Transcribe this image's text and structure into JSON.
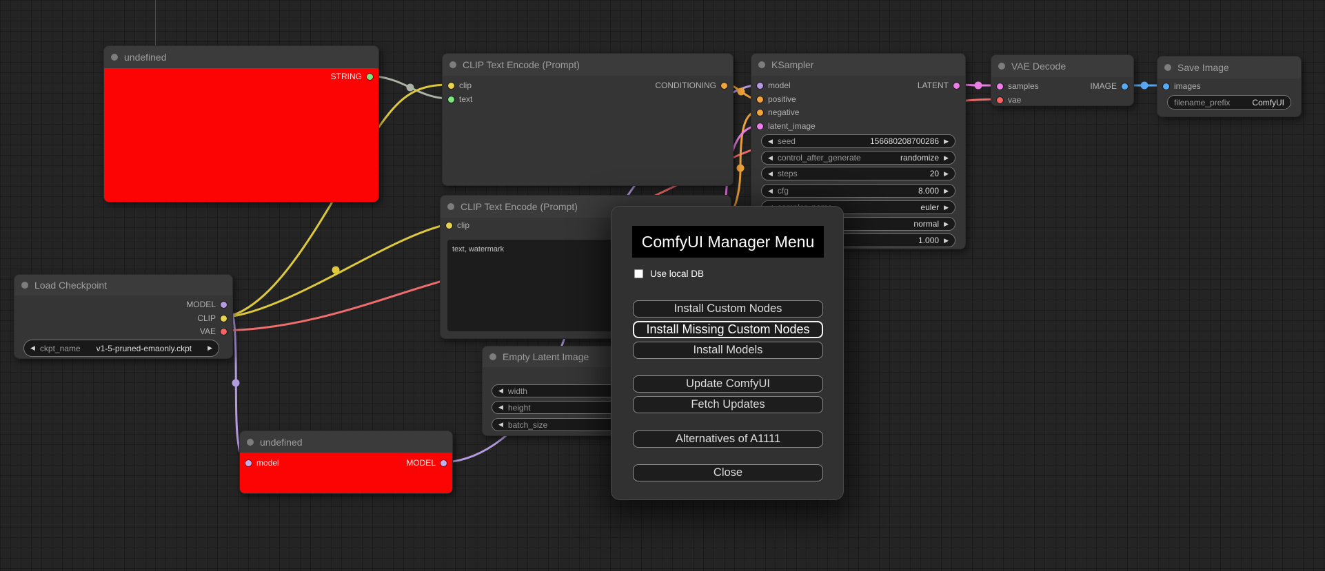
{
  "dialog": {
    "title": "ComfyUI Manager Menu",
    "checkbox_label": "Use local DB",
    "buttons": [
      "Install Custom Nodes",
      "Install Missing Custom Nodes",
      "Install Models",
      "Update ComfyUI",
      "Fetch Updates",
      "Alternatives of A1111",
      "Close"
    ],
    "highlighted_button": "Install Missing Custom Nodes"
  },
  "nodes": {
    "undefined_top": {
      "title": "undefined",
      "outputs": {
        "string": "STRING"
      }
    },
    "clip1": {
      "title": "CLIP Text Encode (Prompt)",
      "inputs": {
        "clip": "clip",
        "text": "text"
      },
      "outputs": {
        "conditioning": "CONDITIONING"
      }
    },
    "ksampler": {
      "title": "KSampler",
      "inputs": {
        "model": "model",
        "positive": "positive",
        "negative": "negative",
        "latent_image": "latent_image"
      },
      "outputs": {
        "latent": "LATENT"
      },
      "widgets": [
        {
          "label": "seed",
          "value": "156680208700286"
        },
        {
          "label": "control_after_generate",
          "value": "randomize"
        },
        {
          "label": "steps",
          "value": "20"
        },
        {
          "label": "cfg",
          "value": "8.000"
        },
        {
          "label": "sampler_name",
          "value": "euler"
        },
        {
          "label": "",
          "value": "normal"
        },
        {
          "label": "",
          "value": "1.000"
        }
      ]
    },
    "vae_decode": {
      "title": "VAE Decode",
      "inputs": {
        "samples": "samples",
        "vae": "vae"
      },
      "outputs": {
        "image": "IMAGE"
      }
    },
    "save_image": {
      "title": "Save Image",
      "inputs": {
        "images": "images"
      },
      "widget": {
        "label": "filename_prefix",
        "value": "ComfyUI"
      }
    },
    "load_checkpoint": {
      "title": "Load Checkpoint",
      "outputs": {
        "model": "MODEL",
        "clip": "CLIP",
        "vae": "VAE"
      },
      "widget": {
        "label": "ckpt_name",
        "value": "v1-5-pruned-emaonly.ckpt"
      }
    },
    "clip2": {
      "title": "CLIP Text Encode (Prompt)",
      "inputs": {
        "clip": "clip"
      },
      "prompt_text": "text, watermark"
    },
    "empty_latent": {
      "title": "Empty Latent Image",
      "widgets": [
        {
          "label": "width"
        },
        {
          "label": "height"
        },
        {
          "label": "batch_size"
        }
      ]
    },
    "undefined_bottom": {
      "title": "undefined",
      "inputs": {
        "model": "model"
      },
      "outputs": {
        "model": "MODEL"
      }
    }
  },
  "icons": {
    "left_arrow": "◀",
    "right_arrow": "▶"
  },
  "colors": {
    "node_error_body": "#fd0404",
    "slot_string_green": "#7de77d",
    "slot_clip_yellow": "#e8d44c",
    "slot_conditioning_orange": "#f2a33c",
    "slot_model_purple": "#b49be0",
    "slot_latent_pink": "#ee7ce8",
    "slot_vae_red": "#f46464",
    "slot_image_blue": "#55aaf5",
    "wire_yellow": "#ddc93c",
    "wire_gray": "#aab3a6",
    "wire_salmon": "#f06d6d",
    "wire_purple": "#b49be0",
    "wire_orange": "#eda23b",
    "wire_pink": "#e97fe2",
    "wire_blue": "#57a8f2"
  }
}
